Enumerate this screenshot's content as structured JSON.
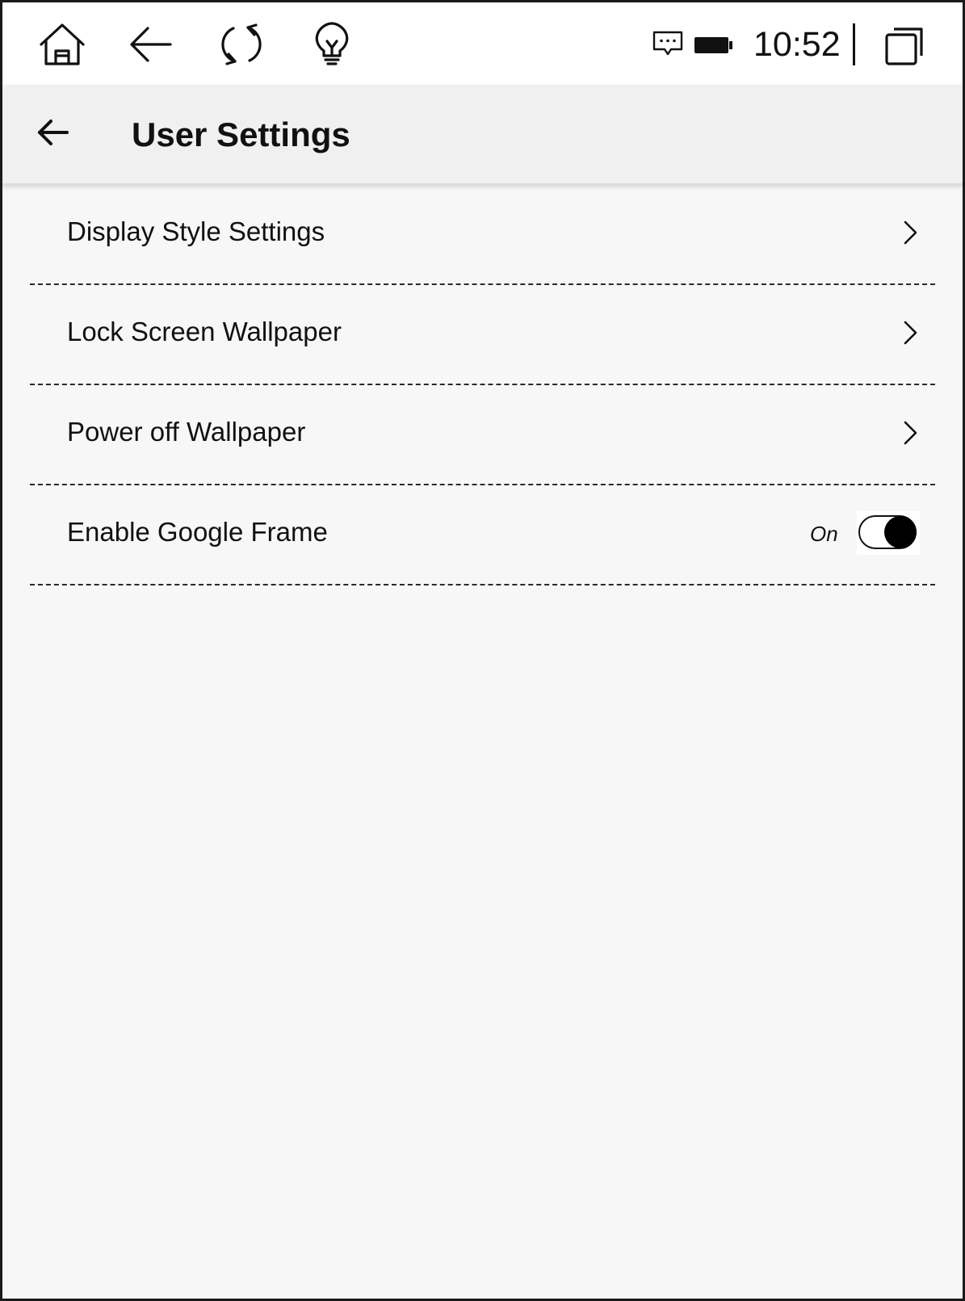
{
  "status_bar": {
    "icons_left": [
      "home-icon",
      "back-arrow-icon",
      "refresh-icon",
      "lightbulb-icon"
    ],
    "icons_right": [
      "message-icon",
      "battery-icon",
      "recent-apps-icon"
    ],
    "time": "10:52"
  },
  "app_bar": {
    "back_icon": "back-arrow-icon",
    "title": "User Settings"
  },
  "settings": {
    "items": [
      {
        "label": "Display Style Settings",
        "type": "link",
        "icon": "chevron-right-icon"
      },
      {
        "label": "Lock Screen Wallpaper",
        "type": "link",
        "icon": "chevron-right-icon"
      },
      {
        "label": "Power off Wallpaper",
        "type": "link",
        "icon": "chevron-right-icon"
      },
      {
        "label": "Enable Google Frame",
        "type": "toggle",
        "state_label": "On",
        "checked": true
      }
    ]
  },
  "colors": {
    "background": "#f7f7f7",
    "status_bar": "#ffffff",
    "app_bar": "#f0f0f0",
    "text": "#111111"
  }
}
